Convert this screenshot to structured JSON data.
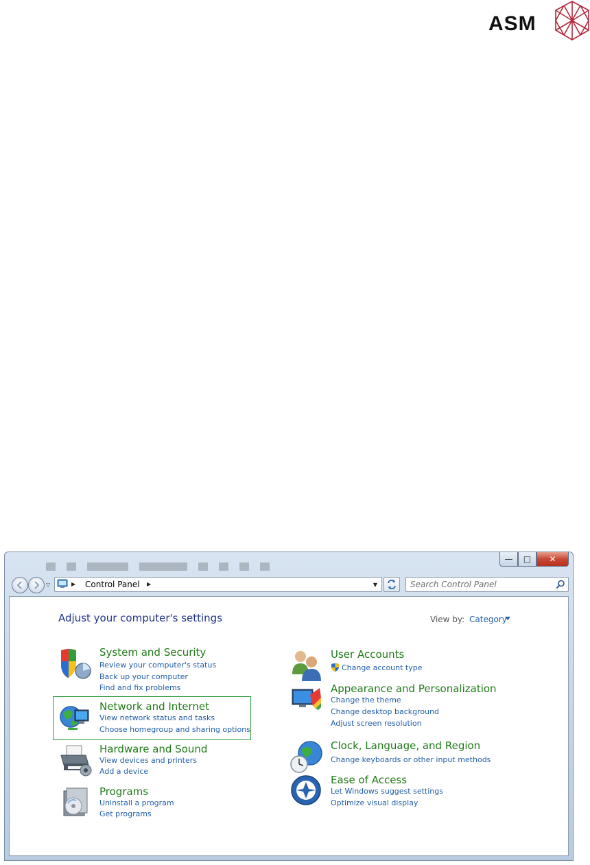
{
  "brand": {
    "name": "ASM",
    "logo_icon": "geodesic-crystal-logo"
  },
  "window": {
    "controls": {
      "minimize": "—",
      "maximize": "□",
      "close": "✕"
    }
  },
  "address_bar": {
    "icon": "control-panel-icon",
    "breadcrumb": [
      "Control Panel"
    ],
    "search_placeholder": "Search Control Panel"
  },
  "content": {
    "title": "Adjust your computer's settings",
    "view_by_label": "View by:",
    "view_by_value": "Category",
    "left_categories": [
      {
        "title": "System and Security",
        "icon": "shield-icon",
        "links": [
          "Review your computer's status",
          "Back up your computer",
          "Find and fix problems"
        ]
      },
      {
        "title": "Network and Internet",
        "icon": "network-globe-icon",
        "links": [
          "View network status and tasks",
          "Choose homegroup and sharing options"
        ],
        "focused": true
      },
      {
        "title": "Hardware and Sound",
        "icon": "printer-icon",
        "links": [
          "View devices and printers",
          "Add a device"
        ]
      },
      {
        "title": "Programs",
        "icon": "programs-icon",
        "links": [
          "Uninstall a program",
          "Get programs"
        ]
      }
    ],
    "right_categories": [
      {
        "title": "User Accounts",
        "icon": "users-icon",
        "links": [
          "Change account type"
        ],
        "link_icon": "uac-shield-icon"
      },
      {
        "title": "Appearance and Personalization",
        "icon": "monitor-paint-icon",
        "links": [
          "Change the theme",
          "Change desktop background",
          "Adjust screen resolution"
        ]
      },
      {
        "title": "Clock, Language, and Region",
        "icon": "globe-clock-icon",
        "links": [
          "Change keyboards or other input methods"
        ]
      },
      {
        "title": "Ease of Access",
        "icon": "ease-of-access-icon",
        "links": [
          "Let Windows suggest settings",
          "Optimize visual display"
        ]
      }
    ]
  },
  "colors": {
    "category_title": "#1e7b16",
    "link": "#1f5ea8",
    "page_title": "#1e3287",
    "focus_border": "#2f9a3a"
  }
}
